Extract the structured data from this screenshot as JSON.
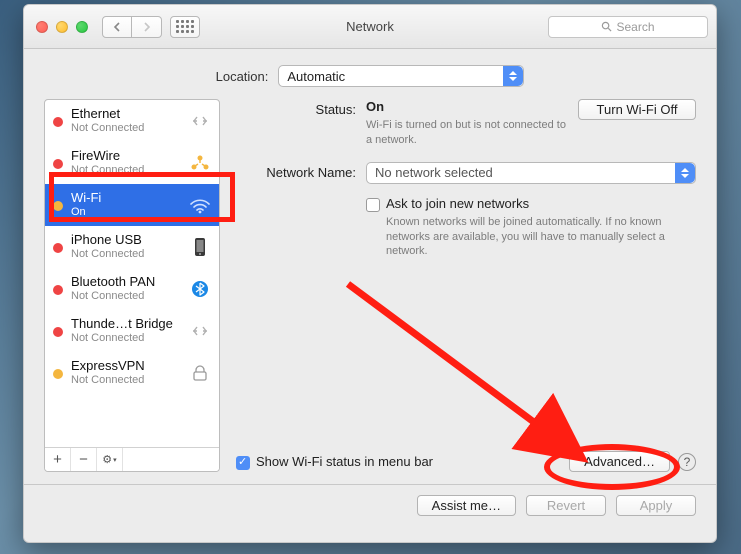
{
  "window": {
    "title": "Network"
  },
  "toolbar": {
    "search_placeholder": "Search"
  },
  "location": {
    "label": "Location:",
    "value": "Automatic"
  },
  "sidebar": {
    "items": [
      {
        "name": "Ethernet",
        "status": "Not Connected",
        "dot": "red",
        "icon": "ethernet"
      },
      {
        "name": "FireWire",
        "status": "Not Connected",
        "dot": "red",
        "icon": "firewire"
      },
      {
        "name": "Wi-Fi",
        "status": "On",
        "dot": "yellow",
        "icon": "wifi",
        "selected": true
      },
      {
        "name": "iPhone USB",
        "status": "Not Connected",
        "dot": "red",
        "icon": "iphone"
      },
      {
        "name": "Bluetooth PAN",
        "status": "Not Connected",
        "dot": "red",
        "icon": "bluetooth"
      },
      {
        "name": "Thunde…t Bridge",
        "status": "Not Connected",
        "dot": "red",
        "icon": "thunderbolt"
      },
      {
        "name": "ExpressVPN",
        "status": "Not Connected",
        "dot": "yellow",
        "icon": "vpn"
      }
    ],
    "add": "+",
    "remove": "−",
    "gear": "⚙"
  },
  "main": {
    "status_label": "Status:",
    "status_value": "On",
    "wifi_toggle": "Turn Wi-Fi Off",
    "status_hint": "Wi-Fi is turned on but is not connected to a network.",
    "netname_label": "Network Name:",
    "netname_value": "No network selected",
    "ask_join_label": "Ask to join new networks",
    "ask_join_hint": "Known networks will be joined automatically. If no known networks are available, you will have to manually select a network.",
    "show_menubar_label": "Show Wi-Fi status in menu bar",
    "advanced": "Advanced…",
    "help": "?"
  },
  "footer": {
    "assist": "Assist me…",
    "revert": "Revert",
    "apply": "Apply"
  }
}
